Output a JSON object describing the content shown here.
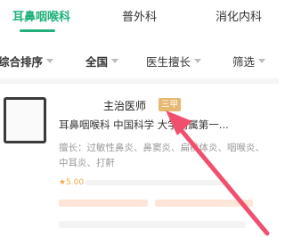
{
  "tabs": [
    {
      "label": "耳鼻咽喉科",
      "active": true
    },
    {
      "label": "普外科",
      "active": false
    },
    {
      "label": "消化内科",
      "active": false
    }
  ],
  "filters": [
    {
      "label": "综合排序"
    },
    {
      "label": "全国"
    },
    {
      "label": "医生擅长"
    },
    {
      "label": "筛选"
    }
  ],
  "doctor": {
    "title": "主治医师",
    "badge": "三甲",
    "department": "耳鼻咽喉科 中国科学 大学附属第一...",
    "specialty": "擅长：过敏性鼻炎、鼻窦炎、扁桃体炎、咽喉炎、中耳炎、打鼾",
    "rating": "5.00"
  },
  "colors": {
    "accent": "#21b07a",
    "badge": "#e7b86f",
    "arrow": "#f0506e"
  }
}
